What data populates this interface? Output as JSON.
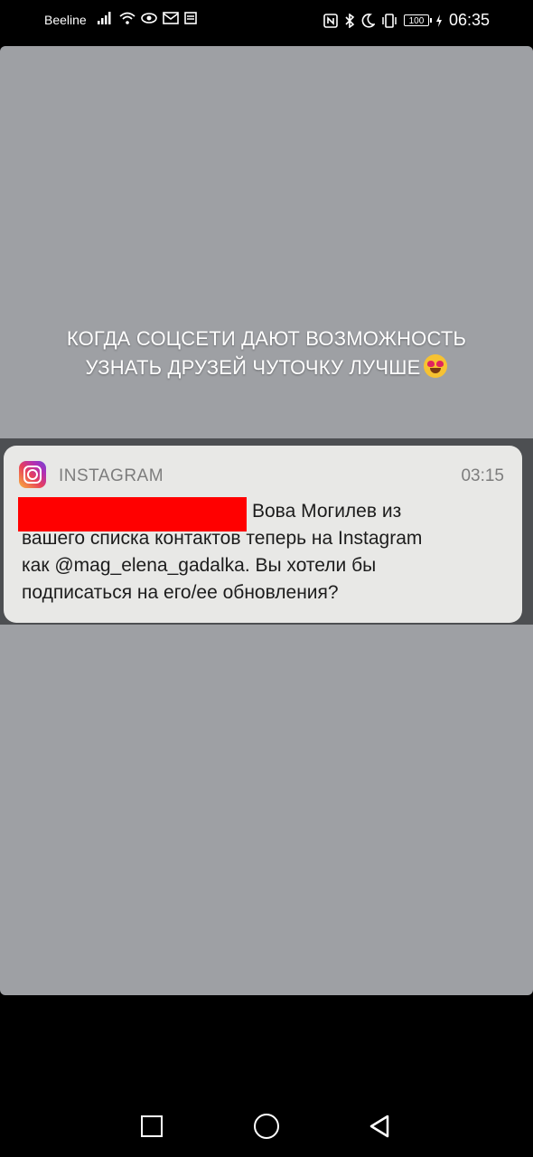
{
  "status_bar": {
    "carrier": "Beeline",
    "battery": "100",
    "time": "06:35",
    "left_icons": [
      "signal-icon",
      "wifi-icon",
      "eye-icon",
      "mail-icon",
      "notes-icon"
    ],
    "right_icons": [
      "nfc-icon",
      "bluetooth-icon",
      "moon-icon",
      "vibrate-icon"
    ]
  },
  "story": {
    "caption_line1": "КОГДА СОЦСЕТИ ДАЮТ ВОЗМОЖНОСТЬ",
    "caption_line2": "УЗНАТЬ ДРУЗЕЙ ЧУТОЧКУ ЛУЧШЕ",
    "emoji": "heart-eyes-emoji",
    "background_color": "#9ea0a4"
  },
  "notification": {
    "app_name": "INSTAGRAM",
    "time": "03:15",
    "line1": "Вова Могилев из",
    "line2": "вашего списка контактов теперь на Instagram",
    "line3": "как @mag_elena_gadalka. Вы хотели бы",
    "line4": "подписаться на его/ее обновления?",
    "redaction_color": "#ff0000"
  },
  "nav_bar": {
    "buttons": [
      "recent-apps-icon",
      "home-icon",
      "back-icon"
    ]
  }
}
